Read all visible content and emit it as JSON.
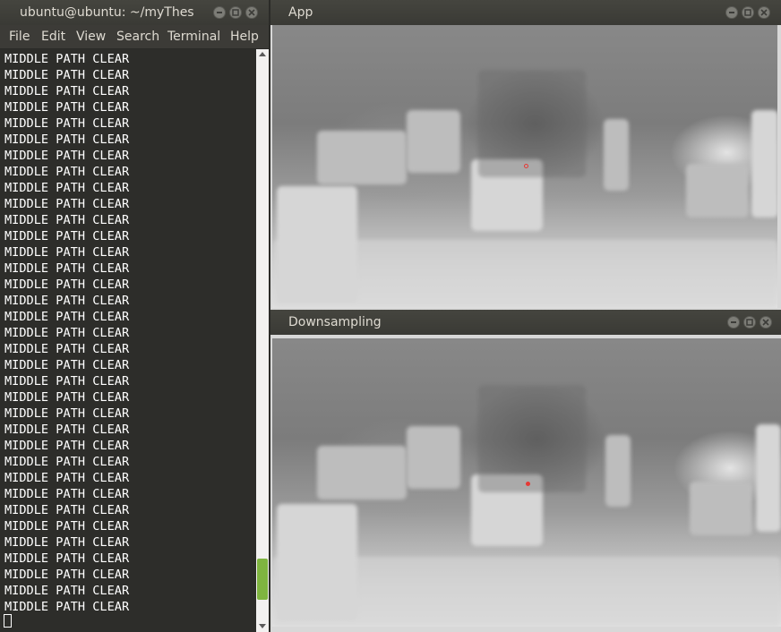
{
  "terminal": {
    "title": "ubuntu@ubuntu: ~/myThes",
    "menu": [
      "File",
      "Edit",
      "View",
      "Search",
      "Terminal",
      "Help"
    ],
    "lines": [
      "MIDDLE PATH CLEAR",
      "MIDDLE PATH CLEAR",
      "MIDDLE PATH CLEAR",
      "MIDDLE PATH CLEAR",
      "MIDDLE PATH CLEAR",
      "MIDDLE PATH CLEAR",
      "MIDDLE PATH CLEAR",
      "MIDDLE PATH CLEAR",
      "MIDDLE PATH CLEAR",
      "MIDDLE PATH CLEAR",
      "MIDDLE PATH CLEAR",
      "MIDDLE PATH CLEAR",
      "MIDDLE PATH CLEAR",
      "MIDDLE PATH CLEAR",
      "MIDDLE PATH CLEAR",
      "MIDDLE PATH CLEAR",
      "MIDDLE PATH CLEAR",
      "MIDDLE PATH CLEAR",
      "MIDDLE PATH CLEAR",
      "MIDDLE PATH CLEAR",
      "MIDDLE PATH CLEAR",
      "MIDDLE PATH CLEAR",
      "MIDDLE PATH CLEAR",
      "MIDDLE PATH CLEAR",
      "MIDDLE PATH CLEAR",
      "MIDDLE PATH CLEAR",
      "MIDDLE PATH CLEAR",
      "MIDDLE PATH CLEAR",
      "MIDDLE PATH CLEAR",
      "MIDDLE PATH CLEAR",
      "MIDDLE PATH CLEAR",
      "MIDDLE PATH CLEAR",
      "MIDDLE PATH CLEAR",
      "MIDDLE PATH CLEAR",
      "MIDDLE PATH CLEAR"
    ],
    "scroll_position": 0.95
  },
  "windows": {
    "app": {
      "title": "App"
    },
    "downsampling": {
      "title": "Downsampling"
    }
  },
  "colors": {
    "terminal_bg": "#2d2d2a",
    "titlebar": "#3c3b37",
    "scroll_thumb": "#7fb440",
    "marker": "#e53935"
  },
  "icons": [
    "minimize-icon",
    "maximize-icon",
    "close-icon",
    "scroll-up-icon",
    "scroll-down-icon"
  ]
}
